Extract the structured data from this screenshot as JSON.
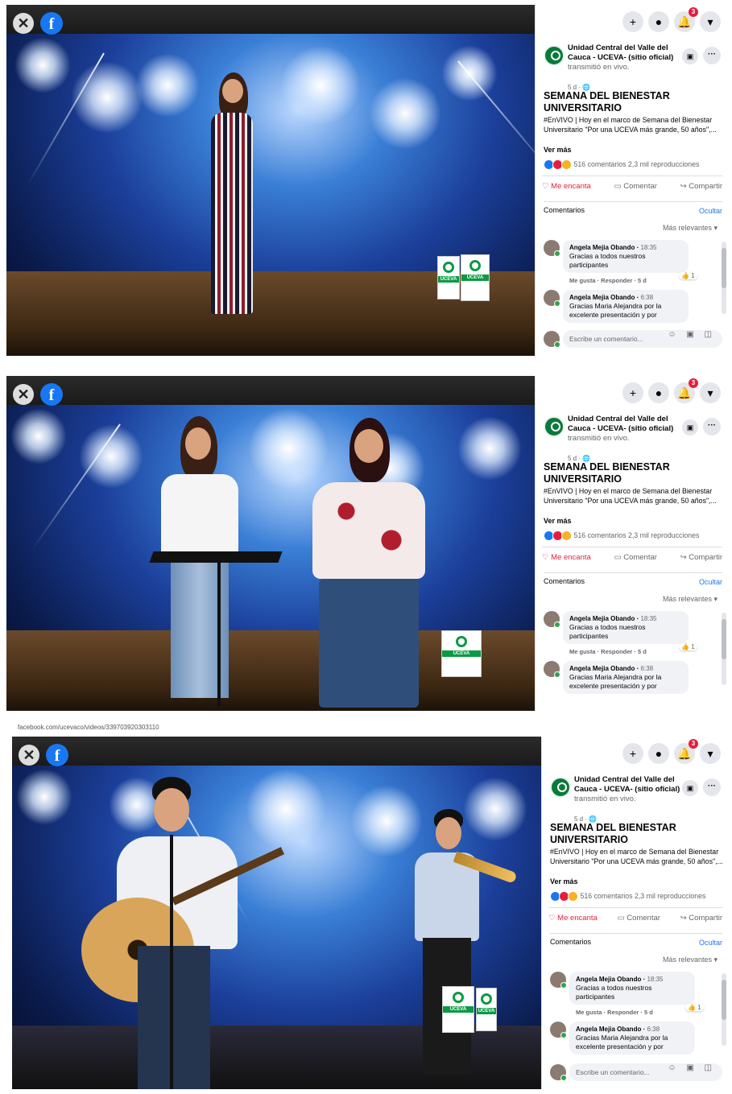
{
  "browser": {
    "url": "facebook.com/ucevaco/videos/339703920303110"
  },
  "controls": {
    "close": "✕",
    "facebook": "f"
  },
  "top_icons": {
    "plus": "+",
    "messenger": "●",
    "notifications_badge": "3",
    "menu": "▾"
  },
  "post": {
    "page_name": "Unidad Central del Valle del Cauca - UCEVA- (sitio oficial)",
    "action": "transmitió en vivo.",
    "meta": "5 d · ",
    "title": "SEMANA DEL BIENESTAR UNIVERSITARIO",
    "description": "#EnVIVO | Hoy en el marco de Semana del Bienestar Universitario \"Por una UCEVA más grande, 50 años\",...",
    "see_more": "Ver más",
    "comments_count": "516 comentarios",
    "views": "2,3 mil reproducciones",
    "like": "Me encanta",
    "comment": "Comentar",
    "share": "Compartir"
  },
  "comments_section": {
    "heading": "Comentarios",
    "hide": "Ocultar",
    "sort": "Más relevantes",
    "input_placeholder": "Escribe un comentario...",
    "items": [
      {
        "author": "Angela Mejia Obando",
        "time": "18:35",
        "text": "Gracias a todos nuestros participantes",
        "footer": "Me gusta · Responder · 5 d",
        "likes": "1"
      },
      {
        "author": "Angela Mejia Obando",
        "time": "6:38",
        "text": "Gracias Maria Alejandra por la excelente presentación y por"
      }
    ]
  },
  "logos": {
    "uceva": "UCEVA"
  },
  "colors": {
    "accent": "#1877f2",
    "love": "#e41e3f",
    "stage_blue": "#1b3f9a",
    "brand_green": "#0a9a44"
  }
}
